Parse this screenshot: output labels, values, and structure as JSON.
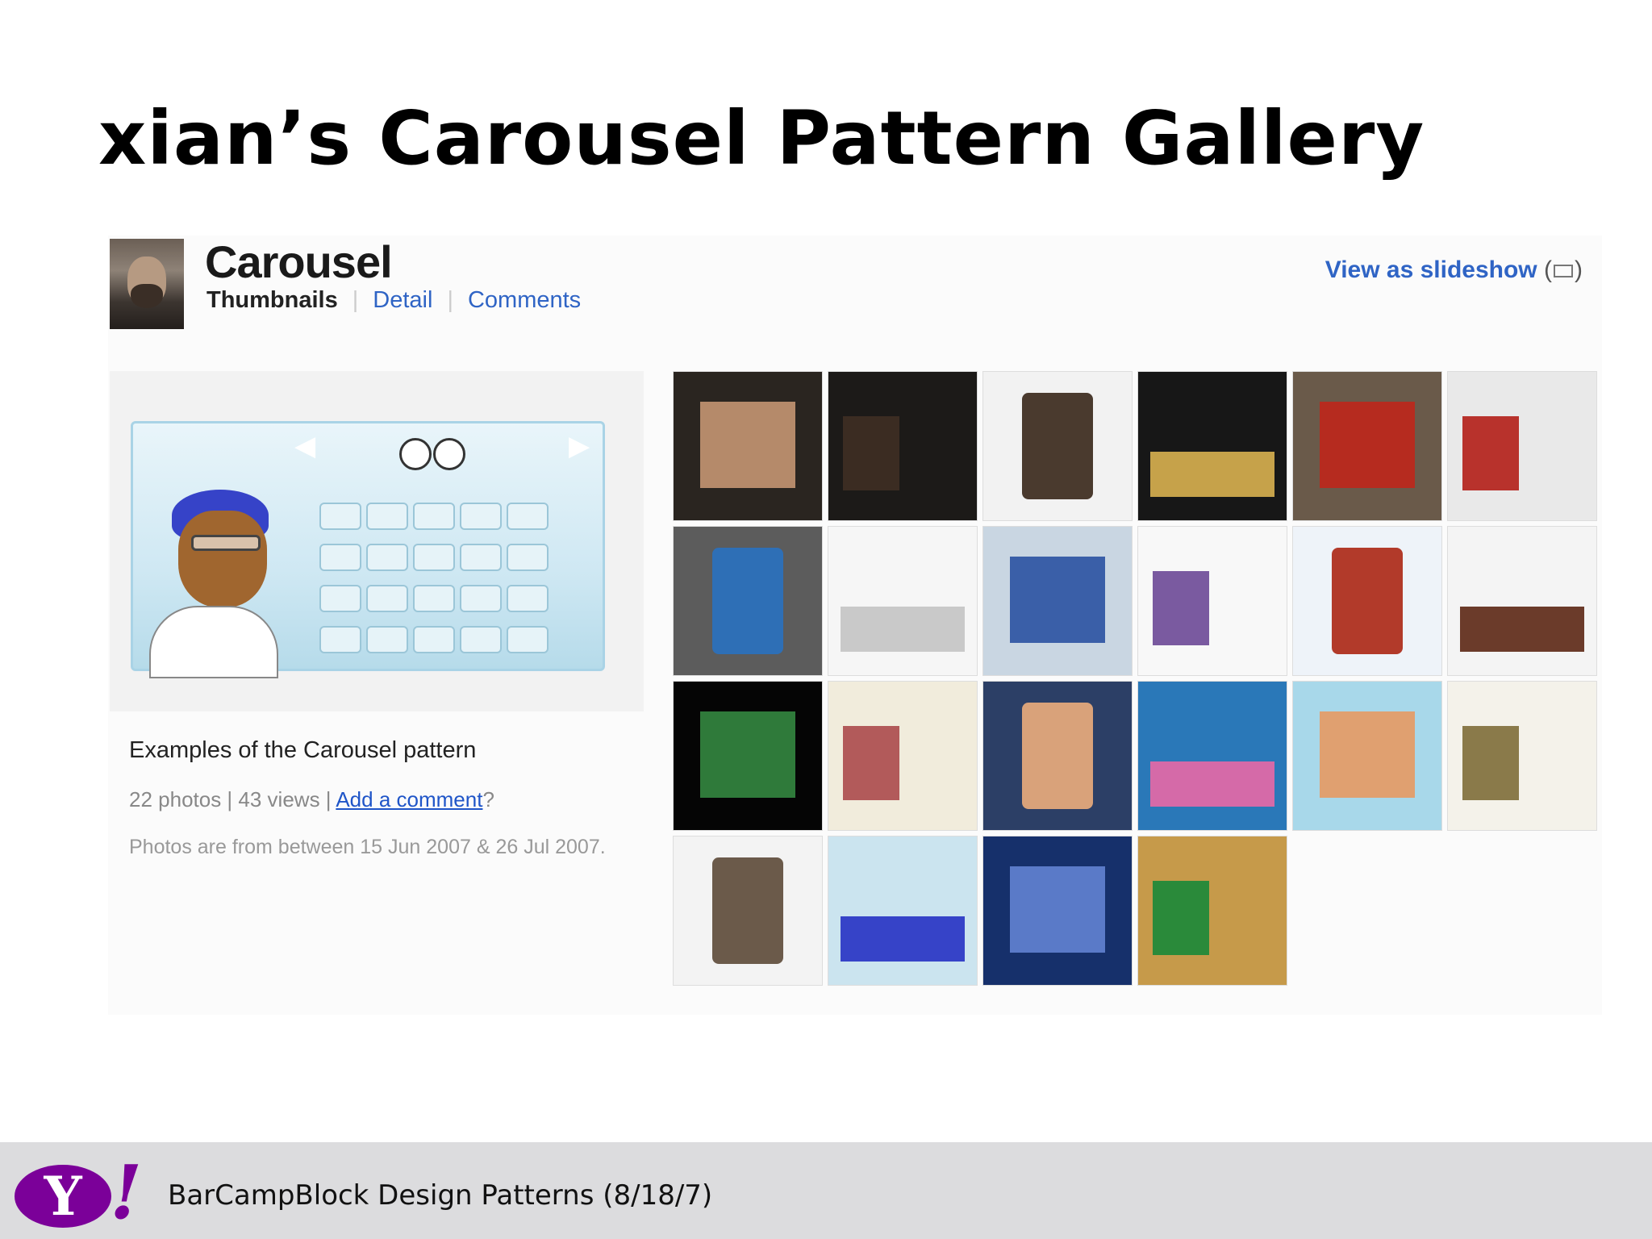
{
  "slide": {
    "title": "xian’s Carousel Pattern Gallery"
  },
  "photo_set": {
    "title": "Carousel",
    "tabs": {
      "thumbnails": "Thumbnails",
      "detail": "Detail",
      "comments": "Comments"
    },
    "slideshow_link": "View as slideshow",
    "slideshow_paren_open": "(",
    "slideshow_paren_close": ")",
    "description": "Examples of the Carousel pattern",
    "stats_text": "22 photos | 43 views | ",
    "add_comment": "Add a comment",
    "stats_suffix": "?",
    "date_range": "Photos are from between 15 Jun 2007 & 26 Jul 2007."
  },
  "thumbnails": [
    {
      "bg": "#2a2520",
      "accent": "#b58a6a"
    },
    {
      "bg": "#1c1a18",
      "accent": "#3b2c22"
    },
    {
      "bg": "#f2f2f2",
      "accent": "#4a3a2e"
    },
    {
      "bg": "#171717",
      "accent": "#c6a24a"
    },
    {
      "bg": "#6a5a4a",
      "accent": "#b62b1f"
    },
    {
      "bg": "#e9e9e9",
      "accent": "#b8322c"
    },
    {
      "bg": "#5c5c5c",
      "accent": "#2e6fb6"
    },
    {
      "bg": "#f6f6f6",
      "accent": "#c9c9c9"
    },
    {
      "bg": "#c9d6e2",
      "accent": "#3a5fa8"
    },
    {
      "bg": "#f8f8f8",
      "accent": "#7a5aa0"
    },
    {
      "bg": "#eef3f9",
      "accent": "#b23a2a"
    },
    {
      "bg": "#f4f4f4",
      "accent": "#6b3b2a"
    },
    {
      "bg": "#050505",
      "accent": "#2f7a3a"
    },
    {
      "bg": "#f1ecdc",
      "accent": "#b25a5a"
    },
    {
      "bg": "#2c3f66",
      "accent": "#d9a27a"
    },
    {
      "bg": "#2a78b8",
      "accent": "#d56aa8"
    },
    {
      "bg": "#a8d8ea",
      "accent": "#e0a070"
    },
    {
      "bg": "#f4f2ea",
      "accent": "#8a7a4a"
    },
    {
      "bg": "#f3f3f3",
      "accent": "#6b5a4a"
    },
    {
      "bg": "#cbe4ef",
      "accent": "#3643c8"
    },
    {
      "bg": "#16306b",
      "accent": "#5a7ac8"
    },
    {
      "bg": "#c69a4a",
      "accent": "#2a8a3a"
    }
  ],
  "footer": {
    "logo_letter": "Y",
    "logo_bang": "!",
    "text": "BarCampBlock Design Patterns (8/18/7)"
  }
}
